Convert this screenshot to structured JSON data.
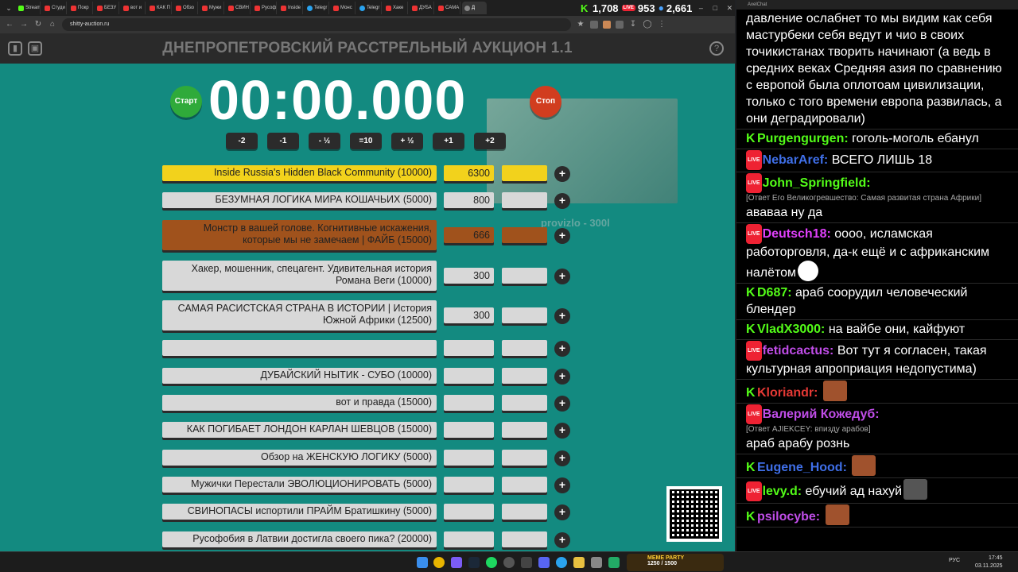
{
  "browser": {
    "tabs": [
      {
        "label": "Stream",
        "favicon": "kick"
      },
      {
        "label": "Студи",
        "favicon": "youtube"
      },
      {
        "label": "Покр",
        "favicon": "youtube"
      },
      {
        "label": "БЕЗУ",
        "favicon": "youtube"
      },
      {
        "label": "вот и",
        "favicon": "youtube"
      },
      {
        "label": "КАК П",
        "favicon": "youtube"
      },
      {
        "label": "Обзо",
        "favicon": "youtube"
      },
      {
        "label": "Мужи",
        "favicon": "youtube"
      },
      {
        "label": "СВИН",
        "favicon": "youtube"
      },
      {
        "label": "Русоф",
        "favicon": "youtube"
      },
      {
        "label": "Inside",
        "favicon": "youtube"
      },
      {
        "label": "Telegr",
        "favicon": "telegram"
      },
      {
        "label": "Монс",
        "favicon": "youtube"
      },
      {
        "label": "Telegr",
        "favicon": "telegram"
      },
      {
        "label": "Хаке",
        "favicon": "youtube"
      },
      {
        "label": "ДУБА",
        "favicon": "youtube"
      },
      {
        "label": "САМА",
        "favicon": "youtube"
      },
      {
        "label": "Д",
        "favicon": "generic",
        "active": true
      }
    ],
    "url": "shitty-auction.ru"
  },
  "stream_stats": {
    "kick_viewers": "1,708",
    "live_label": "LIVE",
    "live_viewers": "953",
    "total_viewers": "2,661"
  },
  "auction": {
    "title": "ДНЕПРОПЕТРОВСКИЙ РАССТРЕЛЬНЫЙ АУКЦИОН 1.1",
    "start_label": "Старт",
    "stop_label": "Стоп",
    "timer": "00:00.000",
    "steps": [
      "-2",
      "-1",
      "- ½",
      "=10",
      "+ ½",
      "+1",
      "+2"
    ],
    "lots": [
      {
        "name": "Inside Russia's Hidden Black Community (10000)",
        "price": "6300",
        "style": "gold"
      },
      {
        "name": "БЕЗУМНАЯ ЛОГИКА МИРА КОШАЧЬИХ (5000)",
        "price": "800",
        "style": "silver"
      },
      {
        "name": "Монстр в вашей голове. Когнитивные искажения,\nкоторые мы не замечаем | ФАЙБ (15000)",
        "price": "666",
        "style": "bronze"
      },
      {
        "name": "Хакер, мошенник, спецагент. Удивительная история\nРомана Веги (10000)",
        "price": "300",
        "style": "plain"
      },
      {
        "name": "САМАЯ РАСИСТСКАЯ СТРАНА В ИСТОРИИ | История\nЮжной Африки (12500)",
        "price": "300",
        "style": "plain"
      },
      {
        "name": "",
        "price": "",
        "style": "plain"
      },
      {
        "name": "ДУБАЙСКИЙ НЫТИК - СУБО (10000)",
        "price": "",
        "style": "plain"
      },
      {
        "name": "вот и правда (15000)",
        "price": "",
        "style": "plain"
      },
      {
        "name": "КАК ПОГИБАЕТ ЛОНДОН КАРЛАН ШЕВЦОВ (15000)",
        "price": "",
        "style": "plain"
      },
      {
        "name": "Обзор на ЖЕНСКУЮ ЛОГИКУ (5000)",
        "price": "",
        "style": "plain"
      },
      {
        "name": "Мужички Перестали ЭВОЛЮЦИОНИРОВАТЬ (5000)",
        "price": "",
        "style": "plain"
      },
      {
        "name": "СВИНОПАСЫ испортили ПРАЙМ Братишкину (5000)",
        "price": "",
        "style": "plain"
      },
      {
        "name": "Русофобия в Латвии достигла своего пика? (20000)",
        "price": "",
        "style": "plain"
      }
    ],
    "add_label": "+",
    "cam_caption": "provizlo - 300l",
    "colors": {
      "background": "#138a80",
      "gold": "#f2d21c",
      "bronze": "#a0521c",
      "start": "#2faa3a",
      "stop": "#d13d1f"
    }
  },
  "chat": {
    "title": "AxelChat",
    "messages": [
      {
        "platform": "",
        "user": "",
        "user_color": "#ffffff",
        "reply": "",
        "text": "давление ослабнет то мы видим как себя мастурбеки себя ведут и чио в своих точикистанах творить начинают (а ведь в средних веках Средняя азия по сравнению с европой была оплотоам цивилизации, только с того времени европа развилась, а они деградировали)",
        "emote": ""
      },
      {
        "platform": "kick",
        "user": "Purgengurgen:",
        "user_color": "#53fc18",
        "reply": "",
        "text": "гоголь-моголь ебанул",
        "emote": ""
      },
      {
        "platform": "live",
        "user": "NebarAref:",
        "user_color": "#3f6fe8",
        "reply": "",
        "text": "ВСЕГО ЛИШЬ 18",
        "emote": ""
      },
      {
        "platform": "live",
        "user": "John_Springfield:",
        "user_color": "#53fc18",
        "reply": "[Ответ Его Великогревшество: Самая развитая страна Африки]",
        "text": "ававаа ну да",
        "emote": ""
      },
      {
        "platform": "live",
        "user": "Deutsch18:",
        "user_color": "#e040fb",
        "reply": "",
        "text": "оооо, исламская работорговля, да-к ещё и с африканским налётом",
        "emote": "face"
      },
      {
        "platform": "kick",
        "user": "D687:",
        "user_color": "#53fc18",
        "reply": "",
        "text": "араб соорудил человеческий блендер",
        "emote": ""
      },
      {
        "platform": "kick",
        "user": "VladX3000:",
        "user_color": "#53fc18",
        "reply": "",
        "text": "на вайбе они, кайфуют",
        "emote": ""
      },
      {
        "platform": "live",
        "user": "fetidcactus:",
        "user_color": "#c04de8",
        "reply": "",
        "text": "Вот тут я согласен, такая культурная апроприация недопустима)",
        "emote": ""
      },
      {
        "platform": "kick",
        "user": "Kloriandr:",
        "user_color": "#e53935",
        "reply": "",
        "text": "",
        "emote": "brown"
      },
      {
        "platform": "live",
        "user": "Валерий Кожедуб:",
        "user_color": "#c04de8",
        "reply": "[Ответ AJIEKCEY: впизду арабов]",
        "text": "араб арабу рознь",
        "emote": ""
      },
      {
        "platform": "kick",
        "user": "Eugene_Hood:",
        "user_color": "#3f6fe8",
        "reply": "",
        "text": "",
        "emote": "brown"
      },
      {
        "platform": "live",
        "user": "levy.d:",
        "user_color": "#53fc18",
        "reply": "",
        "text": "ебучий ад нахуй",
        "emote": "dark"
      },
      {
        "platform": "kick",
        "user": "psilocybe:",
        "user_color": "#c04de8",
        "reply": "",
        "text": "",
        "emote": "brown"
      }
    ]
  },
  "taskbar": {
    "widget_title": "MEME PARTY",
    "widget_progress": "1250 / 1500",
    "lang": "РУС",
    "time": "17:45",
    "date": "03.11.2025"
  }
}
